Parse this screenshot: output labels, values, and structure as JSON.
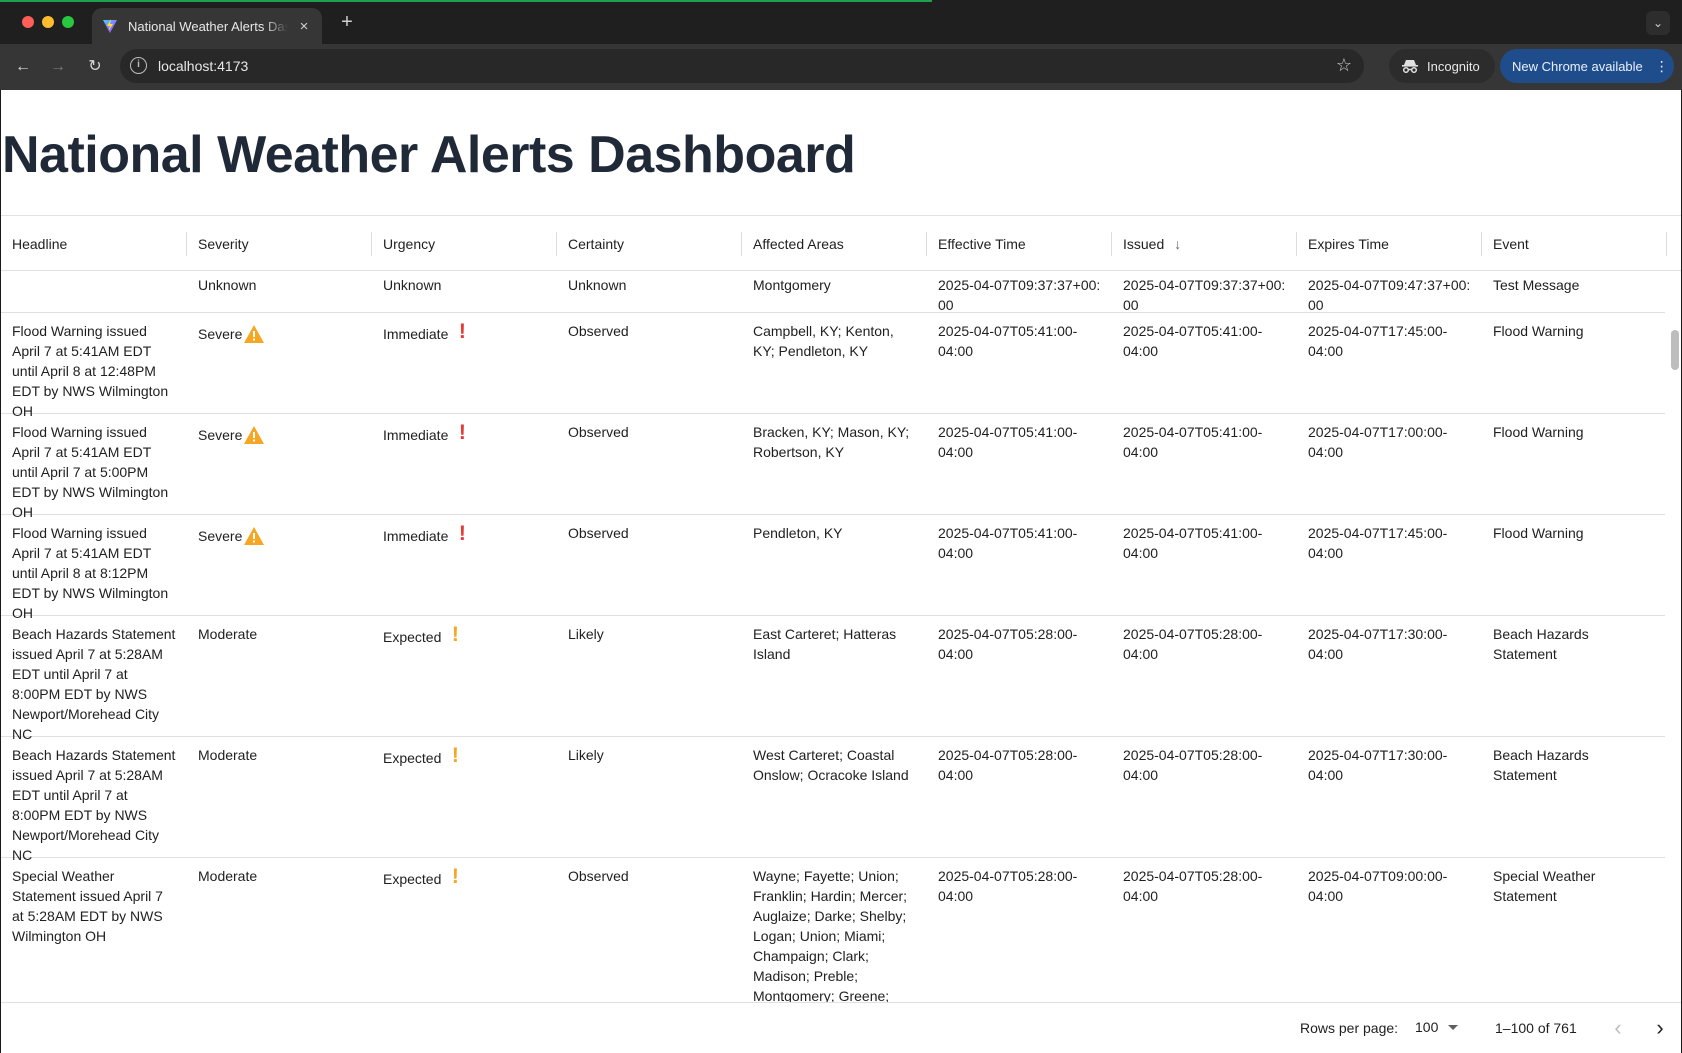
{
  "browser": {
    "tab_title": "National Weather Alerts Dashboard",
    "tab_close": "×",
    "new_tab": "+",
    "url": "localhost:4173",
    "incognito_label": "Incognito",
    "update_label": "New Chrome available"
  },
  "page": {
    "title": "National Weather Alerts Dashboard"
  },
  "table": {
    "columns": [
      "Headline",
      "Severity",
      "Urgency",
      "Certainty",
      "Affected Areas",
      "Effective Time",
      "Issued",
      "Expires Time",
      "Event"
    ],
    "sorted_column": "Issued",
    "sort_direction": "descending",
    "rows": [
      {
        "headline": "",
        "severity": "Unknown",
        "severity_icon": "none",
        "urgency": "Unknown",
        "urgency_icon": "none",
        "certainty": "Unknown",
        "areas": "Montgomery",
        "effective": "2025-04-07T09:37:37+00:00",
        "issued": "2025-04-07T09:37:37+00:00",
        "expires": "2025-04-07T09:47:37+00:00",
        "event": "Test Message"
      },
      {
        "headline": "Flood Warning issued April 7 at 5:41AM EDT until April 8 at 12:48PM EDT by NWS Wilmington OH",
        "severity": "Severe",
        "severity_icon": "warning-triangle",
        "urgency": "Immediate",
        "urgency_icon": "exclamation-red",
        "certainty": "Observed",
        "areas": "Campbell, KY; Kenton, KY; Pendleton, KY",
        "effective": "2025-04-07T05:41:00-04:00",
        "issued": "2025-04-07T05:41:00-04:00",
        "expires": "2025-04-07T17:45:00-04:00",
        "event": "Flood Warning"
      },
      {
        "headline": "Flood Warning issued April 7 at 5:41AM EDT until April 7 at 5:00PM EDT by NWS Wilmington OH",
        "severity": "Severe",
        "severity_icon": "warning-triangle",
        "urgency": "Immediate",
        "urgency_icon": "exclamation-red",
        "certainty": "Observed",
        "areas": "Bracken, KY; Mason, KY; Robertson, KY",
        "effective": "2025-04-07T05:41:00-04:00",
        "issued": "2025-04-07T05:41:00-04:00",
        "expires": "2025-04-07T17:00:00-04:00",
        "event": "Flood Warning"
      },
      {
        "headline": "Flood Warning issued April 7 at 5:41AM EDT until April 8 at 8:12PM EDT by NWS Wilmington OH",
        "severity": "Severe",
        "severity_icon": "warning-triangle",
        "urgency": "Immediate",
        "urgency_icon": "exclamation-red",
        "certainty": "Observed",
        "areas": "Pendleton, KY",
        "effective": "2025-04-07T05:41:00-04:00",
        "issued": "2025-04-07T05:41:00-04:00",
        "expires": "2025-04-07T17:45:00-04:00",
        "event": "Flood Warning"
      },
      {
        "headline": "Beach Hazards Statement issued April 7 at 5:28AM EDT until April 7 at 8:00PM EDT by NWS Newport/Morehead City NC",
        "severity": "Moderate",
        "severity_icon": "none",
        "urgency": "Expected",
        "urgency_icon": "exclamation-orange",
        "certainty": "Likely",
        "areas": "East Carteret; Hatteras Island",
        "effective": "2025-04-07T05:28:00-04:00",
        "issued": "2025-04-07T05:28:00-04:00",
        "expires": "2025-04-07T17:30:00-04:00",
        "event": "Beach Hazards Statement"
      },
      {
        "headline": "Beach Hazards Statement issued April 7 at 5:28AM EDT until April 7 at 8:00PM EDT by NWS Newport/Morehead City NC",
        "severity": "Moderate",
        "severity_icon": "none",
        "urgency": "Expected",
        "urgency_icon": "exclamation-orange",
        "certainty": "Likely",
        "areas": "West Carteret; Coastal Onslow; Ocracoke Island",
        "effective": "2025-04-07T05:28:00-04:00",
        "issued": "2025-04-07T05:28:00-04:00",
        "expires": "2025-04-07T17:30:00-04:00",
        "event": "Beach Hazards Statement"
      },
      {
        "headline": "Special Weather Statement issued April 7 at 5:28AM EDT by NWS Wilmington OH",
        "severity": "Moderate",
        "severity_icon": "none",
        "urgency": "Expected",
        "urgency_icon": "exclamation-orange",
        "certainty": "Observed",
        "areas": "Wayne; Fayette; Union; Franklin; Hardin; Mercer; Auglaize; Darke; Shelby; Logan; Union; Miami; Champaign; Clark; Madison; Preble; Montgomery; Greene;",
        "effective": "2025-04-07T05:28:00-04:00",
        "issued": "2025-04-07T05:28:00-04:00",
        "expires": "2025-04-07T09:00:00-04:00",
        "event": "Special Weather Statement"
      }
    ]
  },
  "pagination": {
    "rows_per_page_label": "Rows per page:",
    "rows_per_page": "100",
    "range": "1–100 of 761",
    "prev": "‹",
    "next": "›"
  },
  "colors": {
    "title": "#1f2937",
    "warning_orange": "#f5a623",
    "immediate_red": "#e53935",
    "update_pill": "#1f4d8c"
  }
}
